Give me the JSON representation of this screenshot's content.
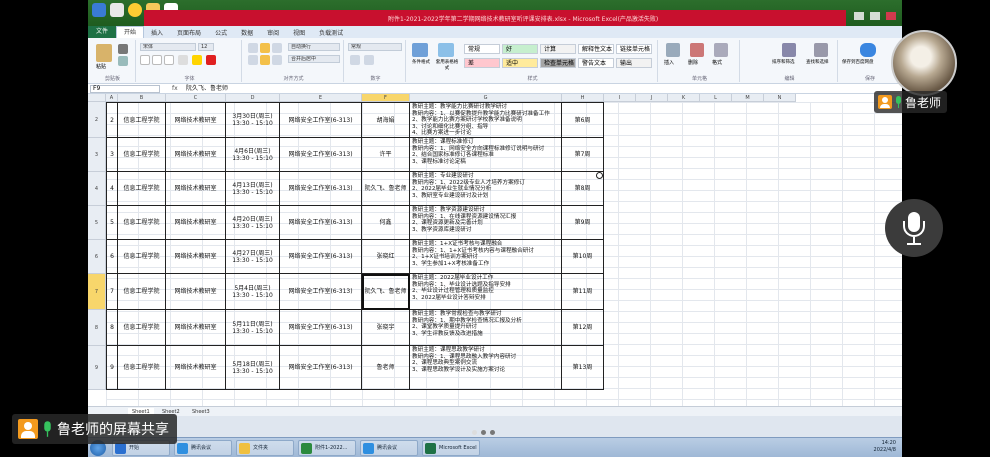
{
  "window": {
    "title": "附件1-2021-2022学年第二学期网络技术教研室听评课安排表.xlsx - Microsoft Excel(产品激活失败)",
    "tabs": [
      "文件",
      "开始",
      "插入",
      "页面布局",
      "公式",
      "数据",
      "审阅",
      "视图",
      "负载测试"
    ],
    "active_tab": "开始"
  },
  "ribbon": {
    "groups": [
      "剪贴板",
      "字体",
      "对齐方式",
      "数字",
      "样式",
      "单元格",
      "编辑",
      "保存"
    ],
    "font_name": "宋体",
    "font_size": "12",
    "wrap_text": "自动换行",
    "merge_center": "合并后居中",
    "number_format": "常规",
    "paste": "粘贴",
    "conditional_format": "条件格式",
    "format_as_table": "套用表格格式",
    "styles": [
      {
        "label": "常规",
        "bg": "#ffffff"
      },
      {
        "label": "差",
        "bg": "#ffc7ce"
      },
      {
        "label": "好",
        "bg": "#c6efce"
      },
      {
        "label": "适中",
        "bg": "#ffeb9c"
      },
      {
        "label": "计算",
        "bg": "#f2f2f2"
      },
      {
        "label": "检查单元格",
        "bg": "#a5a5a5"
      },
      {
        "label": "解释性文本",
        "bg": "#ffffff"
      },
      {
        "label": "警告文本",
        "bg": "#ffffff"
      },
      {
        "label": "链接单元格",
        "bg": "#ffffff"
      },
      {
        "label": "输出",
        "bg": "#f2f2f2"
      }
    ],
    "insert": "插入",
    "delete": "删除",
    "format": "格式",
    "sort_filter": "排序和筛选",
    "find_select": "查找和选择",
    "save_to": "保存到百度网盘"
  },
  "formula_bar": {
    "name_box": "F9",
    "fx": "fx",
    "content": "阮久飞、鲁老师"
  },
  "columns": [
    "A",
    "B",
    "C",
    "D",
    "E",
    "F",
    "G",
    "H",
    "I",
    "J",
    "K",
    "L",
    "M",
    "N"
  ],
  "selected_column": "F",
  "rows": [
    {
      "row_num": "2",
      "no": "2",
      "dept": "信息工程学院",
      "office": "网络技术教研室",
      "time": "3月30日(周三) 13:30 - 15:10",
      "place": "网络安全工作室(6-313)",
      "teacher": "胡海娟",
      "content": "教研主题：教学能力比赛研讨教学研讨\n教研内容：1、以赛促教提升教学能力比赛研讨准备工作\n2、教学能力比赛方案研讨学校教学准备说明\n3、讨论和细化比赛分组、指导\n4、比赛方案进一步讨论",
      "week": "第6周"
    },
    {
      "row_num": "3",
      "no": "3",
      "dept": "信息工程学院",
      "office": "网络技术教研室",
      "time": "4月6日(周三) 13:30 - 15:10",
      "place": "网络安全工作室(6-313)",
      "teacher": "许平",
      "content": "教研主题：课程标准修订\n教研内容：1、网络安全方向课程标准修订说明与研讨\n2、结合国家标准修订各课程标准\n3、课程标准讨论定稿",
      "week": "第7周"
    },
    {
      "row_num": "4",
      "no": "4",
      "dept": "信息工程学院",
      "office": "网络技术教研室",
      "time": "4月13日(周三) 13:30 - 15:10",
      "place": "网络安全工作室(6-313)",
      "teacher": "阮久飞、鲁老师",
      "content": "教研主题：专业建设研讨\n教研内容：1、2022级专业人才培养方案修订\n2、2022届毕业生就业情况分析\n3、教研室专业建设研讨及计划",
      "week": "第8周"
    },
    {
      "row_num": "5",
      "no": "5",
      "dept": "信息工程学院",
      "office": "网络技术教研室",
      "time": "4月20日(周三) 13:30 - 15:10",
      "place": "网络安全工作室(6-313)",
      "teacher": "何鑫",
      "content": "教研主题：教学资源建设研讨\n教研内容：1、在线课程资源建设情况汇报\n2、课程资源更新及完善计划\n3、教学资源库建设研讨",
      "week": "第9周"
    },
    {
      "row_num": "6",
      "no": "6",
      "dept": "信息工程学院",
      "office": "网络技术教研室",
      "time": "4月27日(周三) 13:30 - 15:10",
      "place": "网络安全工作室(6-313)",
      "teacher": "张晓红",
      "content": "教研主题：1+X证书考核与课程融合\n教研内容：1、1+X证书考核内容与课程融合研讨\n2、1+X证书培训方案研讨\n3、学生参加1+X考核准备工作",
      "week": "第10周"
    },
    {
      "row_num": "7",
      "no": "7",
      "dept": "信息工程学院",
      "office": "网络技术教研室",
      "time": "5月4日(周三) 13:30 - 15:10",
      "place": "网络安全工作室(6-313)",
      "teacher": "阮久飞、鲁老师",
      "content": "教研主题：2022届毕业设计工作\n教研内容：1、毕业设计选题及指导安排\n2、毕业设计过程管理和质量监控\n3、2022届毕业设计答辩安排",
      "week": "第11周"
    },
    {
      "row_num": "8",
      "no": "8",
      "dept": "信息工程学院",
      "office": "网络技术教研室",
      "time": "5月11日(周三) 13:30 - 15:10",
      "place": "网络安全工作室(6-313)",
      "teacher": "张晓宇",
      "content": "教研主题：教学常规检查与教学研讨\n教研内容：1、期中教学检查情况汇报及分析\n2、课堂教学质量提升研讨\n3、学生评教反馈及改进措施",
      "week": "第12周"
    },
    {
      "row_num": "9",
      "no": "9",
      "dept": "信息工程学院",
      "office": "网络技术教研室",
      "time": "5月18日(周三) 13:30 - 15:10",
      "place": "网络安全工作室(6-313)",
      "teacher": "鲁老师",
      "content": "教研主题：课程思政教学研讨\n教研内容：1、课程思政融入教学内容研讨\n2、课程思政典型案例交流\n3、课程思政教学设计及实施方案讨论",
      "week": "第13周"
    }
  ],
  "sheet_tabs": [
    "Sheet1",
    "Sheet2",
    "Sheet3"
  ],
  "taskbar": {
    "items": [
      "开始",
      "腾讯会议",
      "文件夹",
      "附件1-2022...",
      "腾讯会议",
      "Microsoft Excel"
    ],
    "clock_time": "14:20",
    "clock_date": "2022/4/8"
  },
  "overlay": {
    "presenter_name": "鲁老师",
    "share_label": "鲁老师的屏幕共享"
  }
}
